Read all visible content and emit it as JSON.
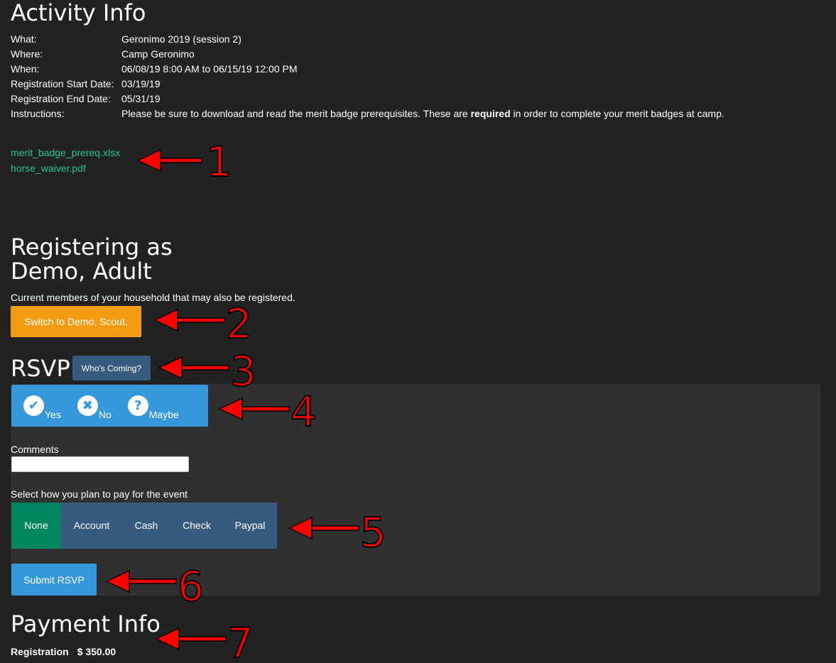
{
  "activity": {
    "title": "Activity Info",
    "rows": [
      {
        "label": "What:",
        "value": "Geronimo 2019 (session 2)"
      },
      {
        "label": "Where:",
        "value": "Camp Geronimo"
      },
      {
        "label": "When:",
        "value": "06/08/19 8:00 AM to 06/15/19 12:00 PM"
      },
      {
        "label": "Registration Start Date:",
        "value": "03/19/19"
      },
      {
        "label": "Registration End Date:",
        "value": "05/31/19"
      }
    ],
    "instructions": {
      "label": "Instructions:",
      "before": "Please be sure to download and read the merit badge prerequisites. These are ",
      "bold": "required",
      "after": " in order to complete your merit badges at camp."
    },
    "attachments": [
      "merit_badge_prereq.xlsx",
      "horse_waiver.pdf"
    ]
  },
  "registration": {
    "heading_line1": "Registering as",
    "heading_line2": "Demo, Adult",
    "household_note": "Current members of your household that may also be registered.",
    "switch_button": "Switch to Demo, Scout."
  },
  "rsvp": {
    "title": "RSVP",
    "whos_coming_button": "Who's Coming?",
    "choices": [
      {
        "label": "Yes",
        "icon": "check-circle-icon",
        "glyph": "✔"
      },
      {
        "label": "No",
        "icon": "x-circle-icon",
        "glyph": "✖"
      },
      {
        "label": "Maybe",
        "icon": "question-circle-icon",
        "glyph": "?"
      }
    ],
    "comments_label": "Comments",
    "comments_value": "",
    "payment_prompt": "Select how you plan to pay for the event",
    "payment_options": [
      "None",
      "Account",
      "Cash",
      "Check",
      "Paypal"
    ],
    "payment_selected": "None",
    "submit_button": "Submit RSVP"
  },
  "payment": {
    "title": "Payment Info",
    "label": "Registration",
    "amount": "$ 350.00"
  },
  "annotations": [
    "1",
    "2",
    "3",
    "4",
    "5",
    "6",
    "7"
  ],
  "colors": {
    "background": "#222222",
    "panel": "#303030",
    "link": "#27c48a",
    "primary": "#3498db",
    "secondary": "#375a7f",
    "warning": "#f39c12",
    "selected": "#00865e",
    "annotation": "#ff0000"
  }
}
